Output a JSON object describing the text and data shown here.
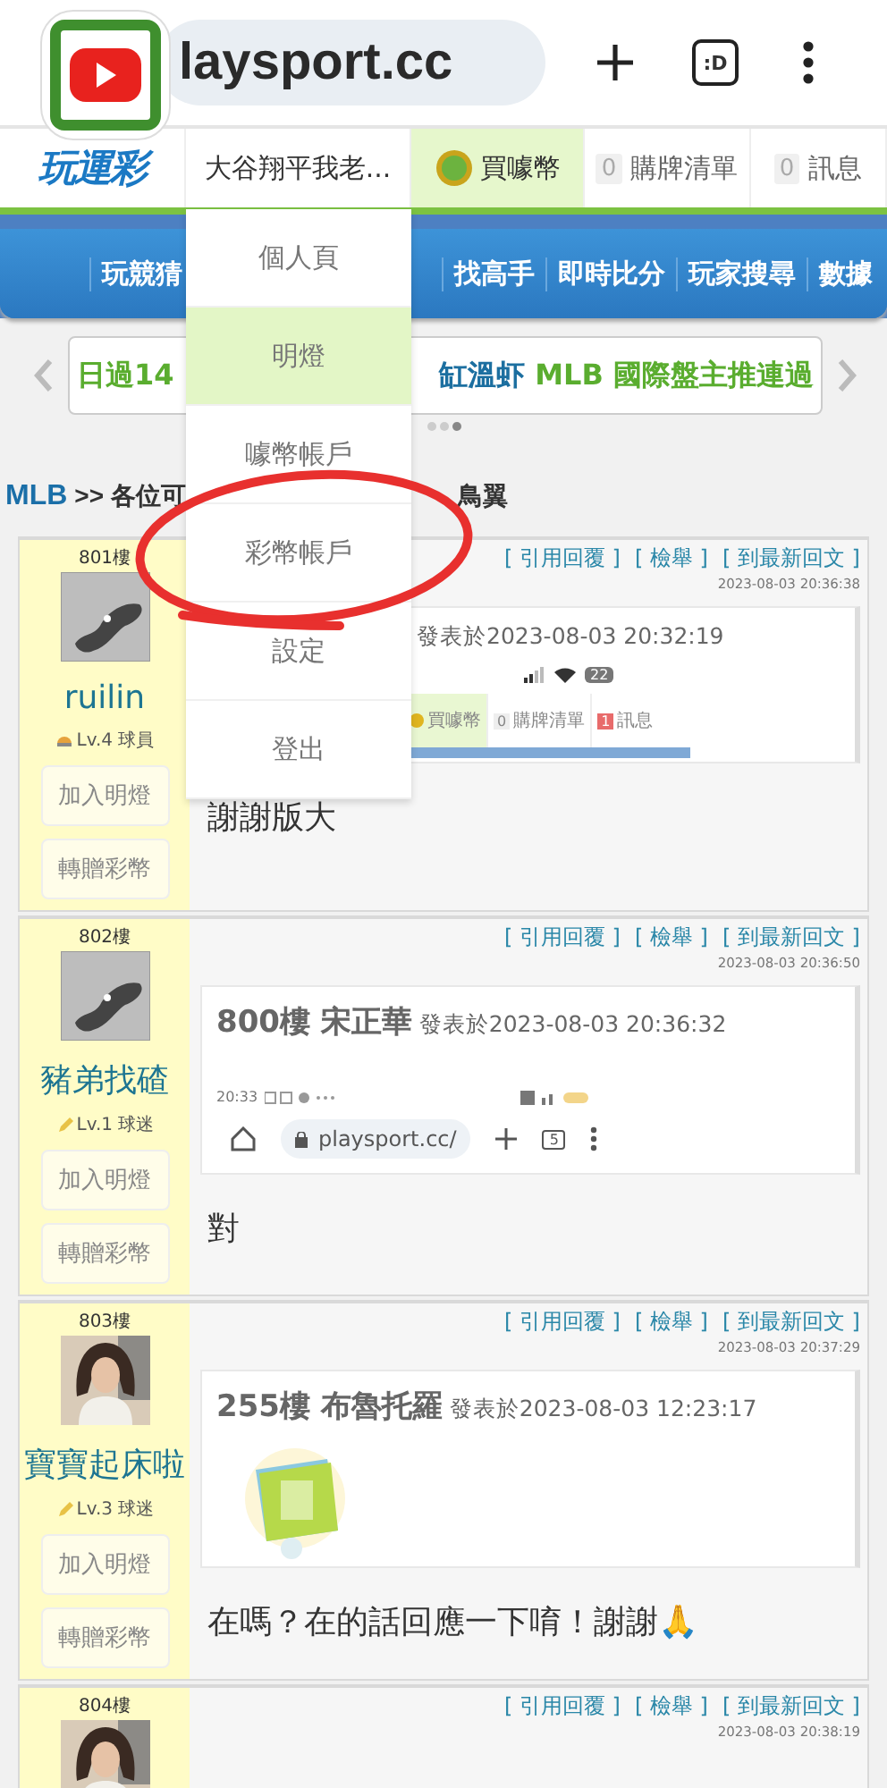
{
  "browser": {
    "url": "laysport.cc",
    "tabs_label": ":D"
  },
  "header": {
    "logo": "玩運彩",
    "user": "大谷翔平我老...",
    "coins": "買噱幣",
    "cart": {
      "count": "0",
      "label": "購牌清單"
    },
    "messages": {
      "count": "0",
      "label": "訊息"
    }
  },
  "nav": [
    "玩競猜",
    "找高手",
    "即時比分",
    "玩家搜尋",
    "數據"
  ],
  "ticker": {
    "left": "日過14",
    "headline_player": "缸溫虾",
    "headline_text": " MLB 國際盤主推連過",
    "pages": [
      {
        "selected": false
      },
      {
        "selected": false
      },
      {
        "selected": true
      }
    ]
  },
  "breadcrumb": {
    "board": "MLB",
    "title_start": ">> 各位可",
    "title_end": "鳥翼"
  },
  "posts": [
    {
      "floor": "801樓",
      "avatar": {
        "kind": "placeholder"
      },
      "username": "ruilin",
      "level": {
        "kind": "ball",
        "text": "Lv.4 球員"
      },
      "buttons": [
        "加入明燈",
        "轉贈彩幣"
      ],
      "actions": [
        "[ 引用回覆 ]",
        "[ 檢舉 ]",
        "[ 到最新回文 ]"
      ],
      "time": "2023-08-03 20:36:38",
      "quote": {
        "meta": "發表於2023-08-03 20:32:19",
        "attachment": {
          "kind": "nav-screenshot",
          "battery": "22",
          "coins": "買噱幣",
          "cart_count": "0",
          "cart": "購牌清單",
          "messages_count": "1",
          "messages": "訊息"
        }
      },
      "body": "謝謝版大"
    },
    {
      "floor": "802樓",
      "avatar": {
        "kind": "placeholder"
      },
      "username": "豬弟找碴",
      "level": {
        "kind": "pencil",
        "text": "Lv.1 球迷"
      },
      "buttons": [
        "加入明燈",
        "轉贈彩幣"
      ],
      "actions": [
        "[ 引用回覆 ]",
        "[ 檢舉 ]",
        "[ 到最新回文 ]"
      ],
      "time": "2023-08-03 20:36:50",
      "quote": {
        "head": "800樓 宋正華",
        "meta": "發表於2023-08-03 20:36:32",
        "attachment": {
          "kind": "browser-screenshot",
          "clock": "20:33",
          "url": "playsport.cc/",
          "tabs": "5"
        }
      },
      "body": "對"
    },
    {
      "floor": "803樓",
      "avatar": {
        "kind": "picture"
      },
      "username": "寶寶起床啦",
      "level": {
        "kind": "pencil",
        "text": "Lv.3 球迷"
      },
      "buttons": [
        "加入明燈",
        "轉贈彩幣"
      ],
      "actions": [
        "[ 引用回覆 ]",
        "[ 檢舉 ]",
        "[ 到最新回文 ]"
      ],
      "time": "2023-08-03 20:37:29",
      "quote": {
        "head": "255樓 布魯托羅",
        "meta": "發表於2023-08-03 12:23:17",
        "attachment": {
          "kind": "sticker"
        }
      },
      "body": "在嗎？在的話回應一下唷！謝謝🙏"
    },
    {
      "floor": "804樓",
      "avatar": {
        "kind": "picture"
      },
      "actions": [
        "[ 引用回覆 ]",
        "[ 檢舉 ]",
        "[ 到最新回文 ]"
      ],
      "time": "2023-08-03 20:38:19"
    }
  ],
  "user_menu": [
    {
      "label": "個人頁",
      "selected": false
    },
    {
      "label": "明燈",
      "selected": true
    },
    {
      "label": "噱幣帳戶",
      "selected": false
    },
    {
      "label": "彩幣帳戶",
      "selected": false
    },
    {
      "label": "設定",
      "selected": false
    },
    {
      "label": "登出",
      "selected": false
    }
  ],
  "annotation": {
    "kind": "circle"
  }
}
